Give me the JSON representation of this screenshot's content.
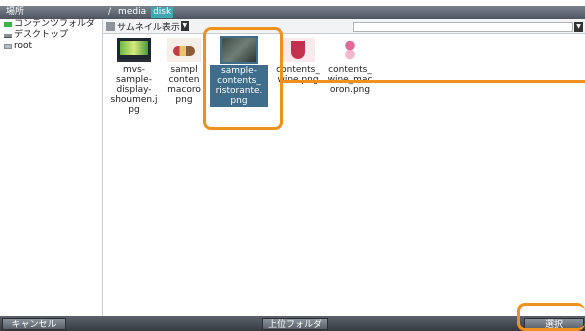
{
  "header": {
    "places_title": "場所",
    "path": [
      "/",
      "media",
      "disk"
    ]
  },
  "sidebar": {
    "items": [
      {
        "label": "コンテンツフォルダ",
        "icon": "folder-green-icon"
      },
      {
        "label": "デスクトップ",
        "icon": "desktop-icon"
      },
      {
        "label": "root",
        "icon": "drive-icon"
      }
    ]
  },
  "view": {
    "mode_label": "サムネイル表示",
    "filename_value": ""
  },
  "files": [
    {
      "name": "mvs-sample-display-shoumen.jpg",
      "lines": [
        "mvs-",
        "sample-",
        "display-",
        "shoumen.j",
        "pg"
      ],
      "thumb": "tv",
      "selected": false
    },
    {
      "name": "sample-contents-macoron.png",
      "lines": [
        "sampl",
        "conten",
        "macoro",
        "png"
      ],
      "thumb": "sweets",
      "selected": false
    },
    {
      "name": "sample-contents_ristorante.png",
      "lines": [
        "sample-",
        "contents_",
        "ristorante.",
        "png"
      ],
      "thumb": "resto",
      "selected": true
    },
    {
      "name": "contents_wine.png",
      "lines": [
        "contents_",
        "wine.png"
      ],
      "thumb": "wine",
      "selected": false
    },
    {
      "name": "contents_wine_macoron.png",
      "lines": [
        "contents_",
        "wine_mac",
        "oron.png"
      ],
      "thumb": "macaron",
      "selected": false
    }
  ],
  "buttons": {
    "cancel": "キャンセル",
    "up_folder": "上位フォルダ",
    "select": "選択"
  },
  "colors": {
    "highlight": "#f0901e",
    "selection": "#3f6d8c",
    "path_current": "#3fa7b0"
  }
}
